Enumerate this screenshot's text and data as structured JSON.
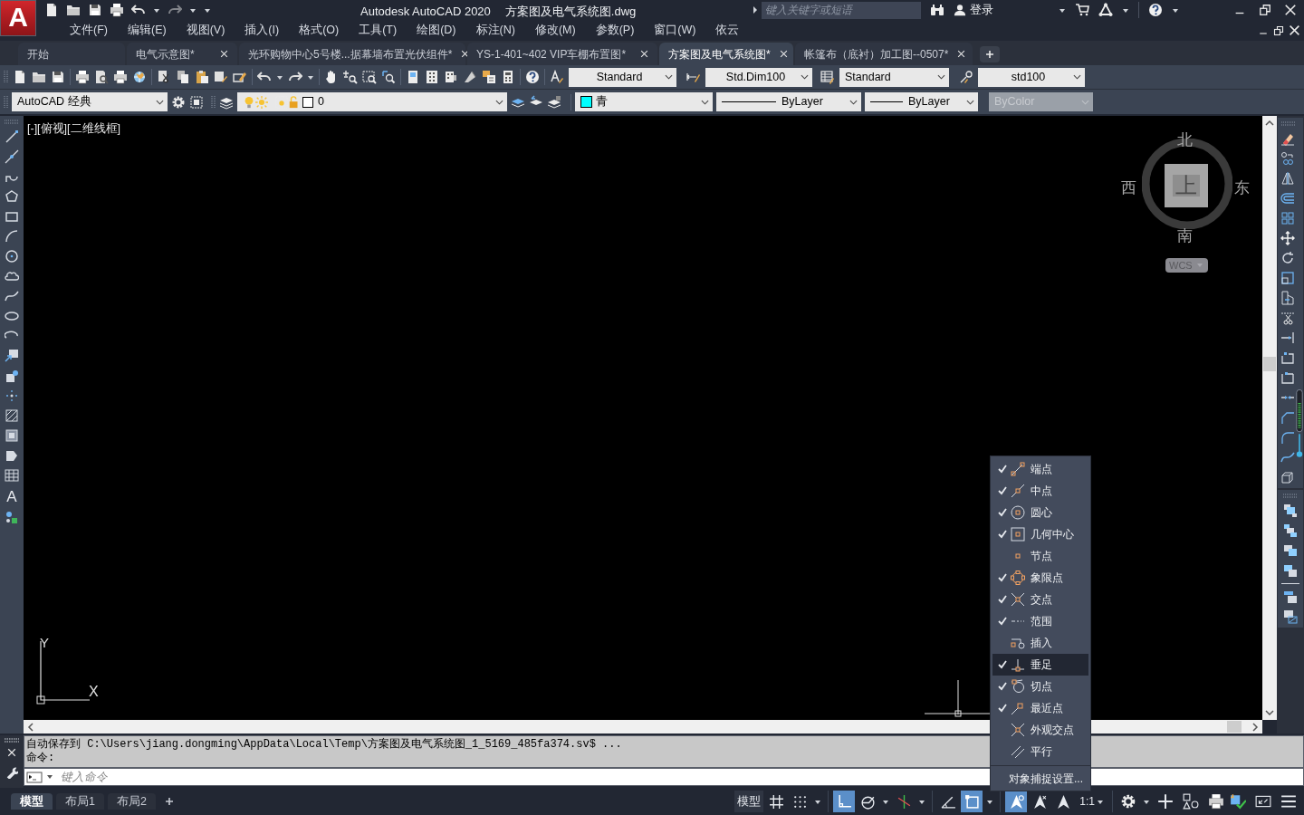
{
  "app_logo": {
    "letter": "A"
  },
  "title_bar": {
    "app_title": "Autodesk AutoCAD 2020",
    "file_name": "方案图及电气系统图.dwg",
    "search": {
      "placeholder": "键入关键字或短语"
    },
    "sign_in": "登录"
  },
  "menu_bar": [
    "文件(F)",
    "编辑(E)",
    "视图(V)",
    "插入(I)",
    "格式(O)",
    "工具(T)",
    "绘图(D)",
    "标注(N)",
    "修改(M)",
    "参数(P)",
    "窗口(W)",
    "依云"
  ],
  "document_tabs": [
    {
      "label": "开始",
      "selected": false,
      "closable": false
    },
    {
      "label": "电气示意图*",
      "selected": false,
      "closable": true
    },
    {
      "label": "光环购物中心5号楼...据幕墙布置光伏组件*",
      "selected": false,
      "closable": true
    },
    {
      "label": "YS-1-401~402 VIP车棚布置图*",
      "selected": false,
      "closable": true
    },
    {
      "label": "方案图及电气系统图*",
      "selected": true,
      "closable": true
    },
    {
      "label": "帐篷布（底衬）加工图--0507*",
      "selected": false,
      "closable": true
    }
  ],
  "styles_toolbar": {
    "text_style": "Standard",
    "dimension_style": "Std.Dim100",
    "table_style": "Standard",
    "multileader_style": "std100"
  },
  "properties_toolbar": {
    "workspace": "AutoCAD 经典",
    "layer": "0",
    "color": {
      "label": "青",
      "color": "#00ffff"
    },
    "linetype": "ByLayer",
    "lineweight": "ByLayer",
    "plot_style": {
      "label": "ByColor",
      "disabled": true
    }
  },
  "draw_toolbar": {
    "text_tool_glyph": "A"
  },
  "viewport": {
    "label": "[-][俯视][二维线框]",
    "viewcube": {
      "north": "北",
      "south": "南",
      "east": "东",
      "west": "西",
      "face": "上",
      "coordinate_system": "WCS"
    },
    "ucs_axes": {
      "y": "Y",
      "x": "X"
    }
  },
  "osnap_menu": {
    "items": [
      {
        "kind": "endpoint",
        "label": "端点",
        "checked": true,
        "selected": false
      },
      {
        "kind": "midpoint",
        "label": "中点",
        "checked": true,
        "selected": false
      },
      {
        "kind": "center",
        "label": "圆心",
        "checked": true,
        "selected": false
      },
      {
        "kind": "geocenter",
        "label": "几何中心",
        "checked": true,
        "selected": false
      },
      {
        "kind": "node",
        "label": "节点",
        "checked": false,
        "selected": false
      },
      {
        "kind": "quadrant",
        "label": "象限点",
        "checked": true,
        "selected": false
      },
      {
        "kind": "intersection",
        "label": "交点",
        "checked": true,
        "selected": false
      },
      {
        "kind": "extension",
        "label": "范围",
        "checked": true,
        "selected": false
      },
      {
        "kind": "insertion",
        "label": "插入",
        "checked": false,
        "selected": false
      },
      {
        "kind": "perpendicular",
        "label": "垂足",
        "checked": true,
        "selected": true
      },
      {
        "kind": "tangent",
        "label": "切点",
        "checked": true,
        "selected": false
      },
      {
        "kind": "nearest",
        "label": "最近点",
        "checked": true,
        "selected": false
      },
      {
        "kind": "apparent",
        "label": "外观交点",
        "checked": false,
        "selected": false
      },
      {
        "kind": "parallel",
        "label": "平行",
        "checked": false,
        "selected": false
      }
    ],
    "settings": "对象捕捉设置..."
  },
  "command_line": {
    "history": [
      "自动保存到 C:\\Users\\jiang.dongming\\AppData\\Local\\Temp\\方案图及电气系统图_1_5169_485fa374.sv$ ...",
      "命令:"
    ],
    "placeholder": "键入命令"
  },
  "layout_tabs": [
    {
      "label": "模型",
      "selected": true
    },
    {
      "label": "布局1",
      "selected": false
    },
    {
      "label": "布局2",
      "selected": false
    }
  ],
  "status_bar": {
    "space": "模型",
    "annotation_scale": "1:1",
    "toggles": [
      {
        "kind": "grid",
        "on": false,
        "dropdown": false
      },
      {
        "kind": "snap",
        "on": false,
        "dropdown": true
      },
      {
        "kind": "ortho",
        "on": true,
        "dropdown": false
      },
      {
        "kind": "polar",
        "on": false,
        "dropdown": true
      },
      {
        "kind": "isodraft",
        "on": false,
        "dropdown": true
      },
      {
        "kind": "tracking",
        "on": false,
        "dropdown": false
      },
      {
        "kind": "osnap",
        "on": true,
        "dropdown": true
      },
      {
        "kind": "annotation_visibility",
        "on": true,
        "dropdown": false
      },
      {
        "kind": "autoscale",
        "on": false,
        "dropdown": false
      },
      {
        "kind": "annotation",
        "on": false,
        "dropdown": false
      }
    ]
  }
}
